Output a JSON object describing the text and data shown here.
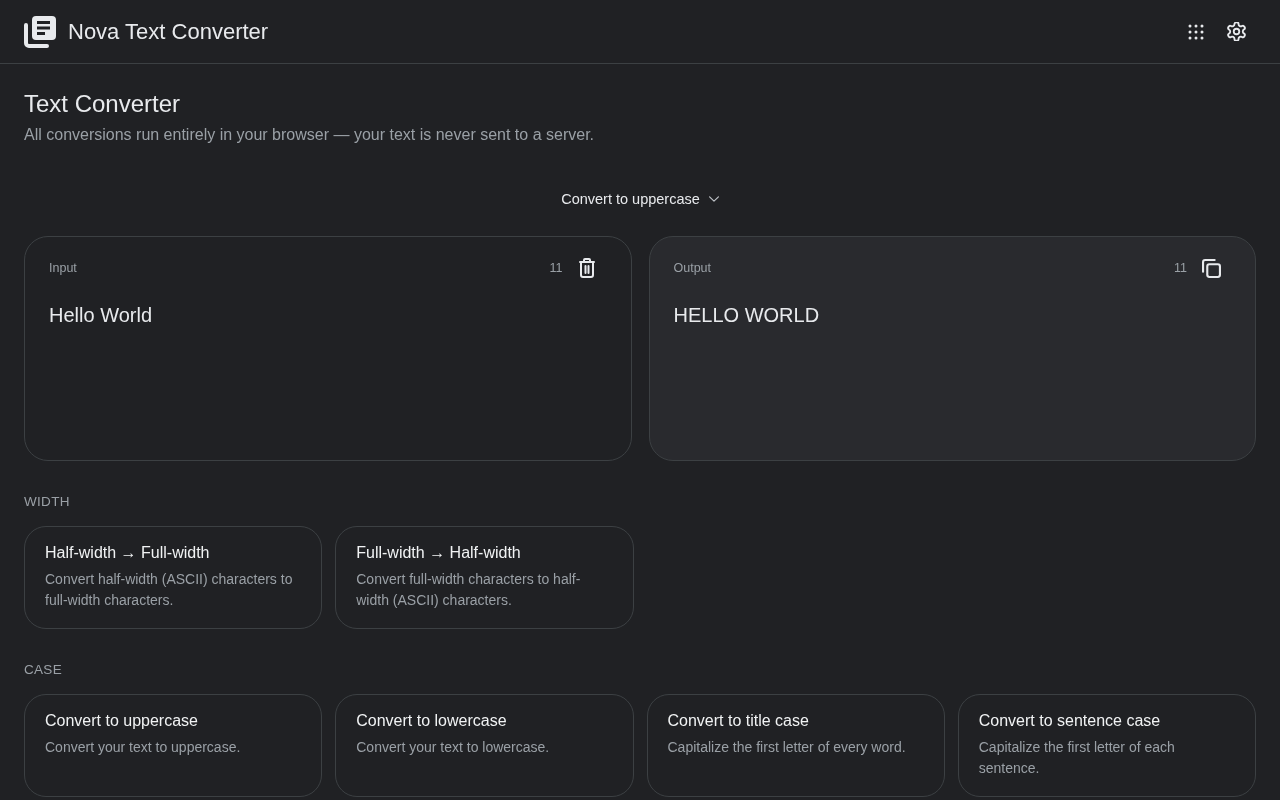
{
  "app": {
    "title": "Nova Text Converter"
  },
  "page": {
    "title": "Text Converter",
    "subtitle": "All conversions run entirely in your browser — your text is never sent to a server."
  },
  "mode_select": {
    "value": "Convert to uppercase"
  },
  "input": {
    "label": "Input",
    "count": "11",
    "value": "Hello World"
  },
  "output": {
    "label": "Output",
    "count": "11",
    "value": "HELLO WORLD"
  },
  "sections": [
    {
      "heading": "WIDTH",
      "tools": [
        {
          "title": "Half-width → Full-width",
          "description": "Convert half-width (ASCII) characters to full-width characters."
        },
        {
          "title": "Full-width → Half-width",
          "description": "Convert full-width characters to half-width (ASCII) characters."
        }
      ]
    },
    {
      "heading": "CASE",
      "tools": [
        {
          "title": "Convert to uppercase",
          "description": "Convert your text to uppercase."
        },
        {
          "title": "Convert to lowercase",
          "description": "Convert your text to lowercase."
        },
        {
          "title": "Convert to title case",
          "description": "Capitalize the first letter of every word."
        },
        {
          "title": "Convert to sentence case",
          "description": "Capitalize the first letter of each sentence."
        }
      ]
    }
  ]
}
